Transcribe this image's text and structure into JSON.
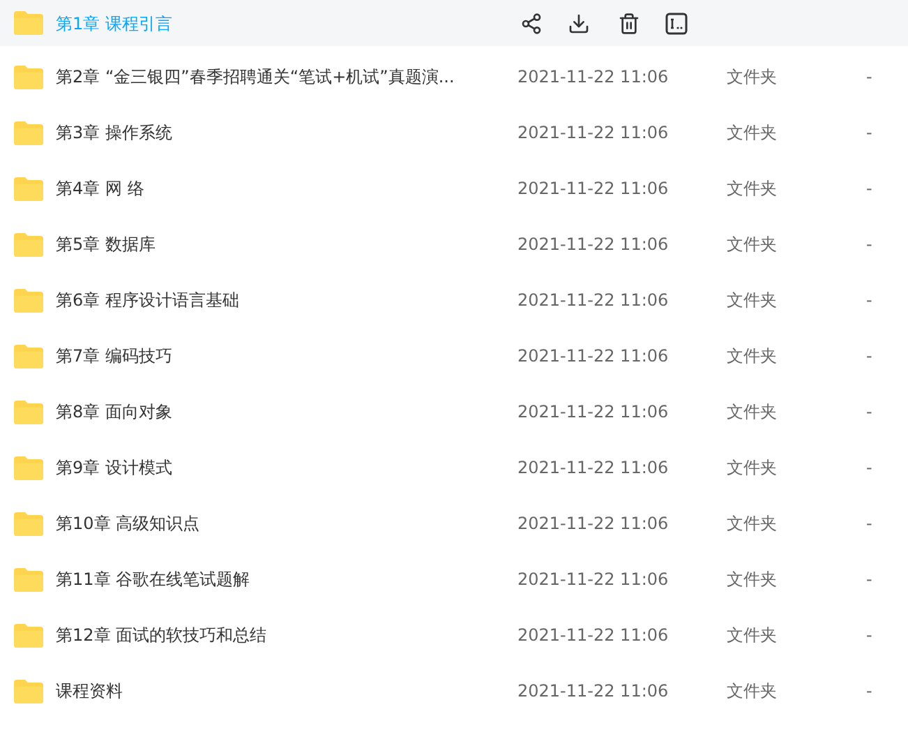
{
  "files": [
    {
      "name": "第1章 课程引言",
      "selected": true
    },
    {
      "name": "第2章 “金三银四”春季招聘通关“笔试+机试”真题演...",
      "date": "2021-11-22 11:06",
      "type": "文件夹",
      "size": "-",
      "selected": false
    },
    {
      "name": "第3章 操作系统",
      "date": "2021-11-22 11:06",
      "type": "文件夹",
      "size": "-",
      "selected": false
    },
    {
      "name": "第4章 网 络",
      "date": "2021-11-22 11:06",
      "type": "文件夹",
      "size": "-",
      "selected": false
    },
    {
      "name": "第5章 数据库",
      "date": "2021-11-22 11:06",
      "type": "文件夹",
      "size": "-",
      "selected": false
    },
    {
      "name": "第6章 程序设计语言基础",
      "date": "2021-11-22 11:06",
      "type": "文件夹",
      "size": "-",
      "selected": false
    },
    {
      "name": "第7章 编码技巧",
      "date": "2021-11-22 11:06",
      "type": "文件夹",
      "size": "-",
      "selected": false
    },
    {
      "name": "第8章 面向对象",
      "date": "2021-11-22 11:06",
      "type": "文件夹",
      "size": "-",
      "selected": false
    },
    {
      "name": "第9章 设计模式",
      "date": "2021-11-22 11:06",
      "type": "文件夹",
      "size": "-",
      "selected": false
    },
    {
      "name": "第10章 高级知识点",
      "date": "2021-11-22 11:06",
      "type": "文件夹",
      "size": "-",
      "selected": false
    },
    {
      "name": "第11章 谷歌在线笔试题解",
      "date": "2021-11-22 11:06",
      "type": "文件夹",
      "size": "-",
      "selected": false
    },
    {
      "name": "第12章 面试的软技巧和总结",
      "date": "2021-11-22 11:06",
      "type": "文件夹",
      "size": "-",
      "selected": false
    },
    {
      "name": "课程资料",
      "date": "2021-11-22 11:06",
      "type": "文件夹",
      "size": "-",
      "selected": false
    }
  ]
}
